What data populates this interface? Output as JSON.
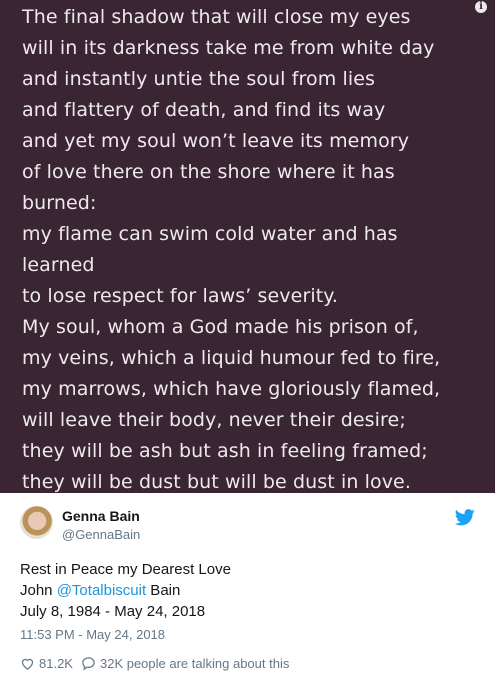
{
  "poem": {
    "lines": [
      "The final shadow that will close my eyes",
      "will in its darkness take me from white day",
      "and instantly untie the soul from lies",
      "and flattery of death, and find its way",
      "and yet my soul won’t leave its memory",
      "of love there on the shore where it has",
      "burned:",
      "my flame can swim cold water and has",
      "learned",
      "to lose respect for laws’ severity.",
      "My soul, whom a God made his prison of,",
      "my veins, which a liquid humour fed to fire,",
      "my marrows, which have gloriously flamed,",
      "will leave their body, never their desire;",
      "they will be ash but ash in feeling framed;",
      "they will be dust but will be dust in love."
    ],
    "info_icon": "info-icon"
  },
  "tweet": {
    "author_name": "Genna Bain",
    "author_handle": "@GennaBain",
    "line1": "Rest in Peace my Dearest Love",
    "line2_prefix": "John ",
    "line2_mention": "@Totalbiscuit",
    "line2_suffix": " Bain",
    "line3": "July 8, 1984 - May 24, 2018",
    "timestamp": "11:53 PM - May 24, 2018",
    "likes": "81.2K",
    "talking": "32K people are talking about this",
    "brand_color": "#1da1f2",
    "mention_color": "#1b95e0",
    "icons": [
      "avatar",
      "twitter-bird-icon",
      "heart-icon",
      "comment-bubble-icon"
    ]
  }
}
